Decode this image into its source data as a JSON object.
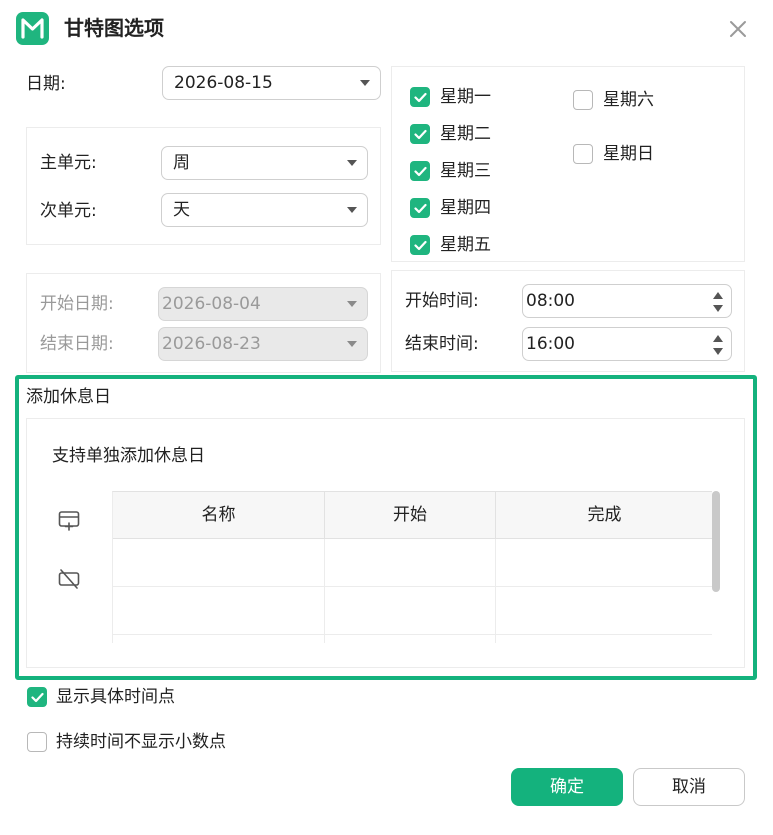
{
  "dialog": {
    "title": "甘特图选项"
  },
  "date": {
    "label": "日期:",
    "value": "2026-08-15"
  },
  "units": {
    "major_label": "主单元:",
    "major_value": "周",
    "minor_label": "次单元:",
    "minor_value": "天"
  },
  "weekdays": [
    {
      "label": "星期一",
      "checked": true
    },
    {
      "label": "星期二",
      "checked": true
    },
    {
      "label": "星期三",
      "checked": true
    },
    {
      "label": "星期四",
      "checked": true
    },
    {
      "label": "星期五",
      "checked": true
    },
    {
      "label": "星期六",
      "checked": false
    },
    {
      "label": "星期日",
      "checked": false
    }
  ],
  "range": {
    "start_label": "开始日期:",
    "start_value": "2026-08-04",
    "end_label": "结束日期:",
    "end_value": "2026-08-23"
  },
  "work_time": {
    "start_label": "开始时间:",
    "start_value": "08:00",
    "end_label": "结束时间:",
    "end_value": "16:00"
  },
  "holidays": {
    "section_title": "添加休息日",
    "hint": "支持单独添加休息日",
    "columns": [
      "名称",
      "开始",
      "完成"
    ],
    "rows": [
      [
        "",
        "",
        ""
      ],
      [
        "",
        "",
        ""
      ],
      [
        "",
        "",
        ""
      ]
    ]
  },
  "options": {
    "show_time_points": {
      "label": "显示具体时间点",
      "checked": true
    },
    "no_decimal_duration": {
      "label": "持续时间不显示小数点",
      "checked": false
    }
  },
  "buttons": {
    "ok": "确定",
    "cancel": "取消"
  },
  "colors": {
    "accent": "#14b27d",
    "checkbox_checked": "#1fb57f"
  }
}
